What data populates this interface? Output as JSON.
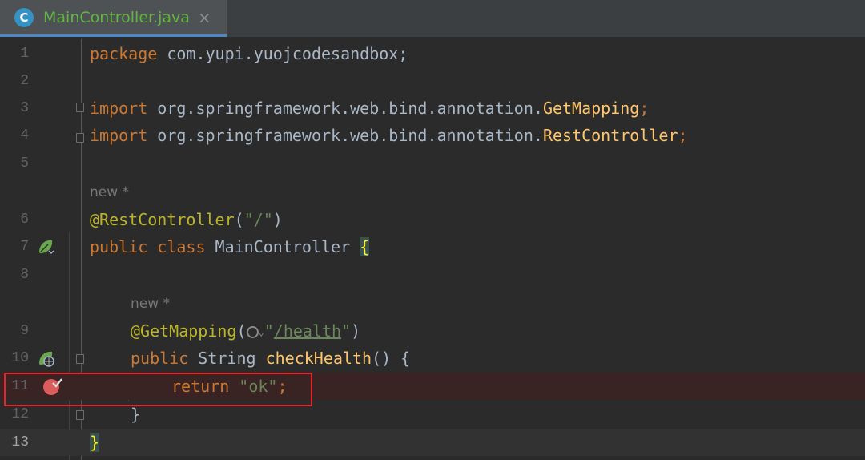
{
  "tab": {
    "icon_letter": "C",
    "title": "MainController.java",
    "close": "×"
  },
  "hints": {
    "class_hint": "new *",
    "method_hint": "new *"
  },
  "lines": {
    "l1": {
      "num": "1",
      "kw": "package",
      "rest": " com.yupi.yuojcodesandbox;"
    },
    "l2": {
      "num": "2"
    },
    "l3": {
      "num": "3",
      "kw": "import",
      "rest": " org.springframework.web.bind.annotation.",
      "cls": "GetMapping",
      "semi": ";"
    },
    "l4": {
      "num": "4",
      "kw": "import",
      "rest": " org.springframework.web.bind.annotation.",
      "cls": "RestController",
      "semi": ";"
    },
    "l5": {
      "num": "5"
    },
    "l6": {
      "num": "6",
      "ann": "@RestController",
      "open": "(",
      "str": "\"/\"",
      "close": ")"
    },
    "l7": {
      "num": "7",
      "kw": "public class",
      "rest": " MainController ",
      "brace": "{"
    },
    "l8": {
      "num": "8"
    },
    "l9": {
      "num": "9",
      "ann": "@GetMapping",
      "open": "(",
      "q1": "\"",
      "path": "/health",
      "q2": "\"",
      "close": ")"
    },
    "l10": {
      "num": "10",
      "kw": "public",
      "rest": " String ",
      "fn": "checkHealth",
      "tail": "() {"
    },
    "l11": {
      "num": "11",
      "kw": "return",
      "sp": " ",
      "str": "\"ok\"",
      "semi": ";"
    },
    "l12": {
      "num": "12",
      "brace": "}"
    },
    "l13": {
      "num": "13",
      "brace": "}"
    }
  },
  "colors": {
    "keyword": "#cc7832",
    "annotation": "#bbb529",
    "string": "#6a8759",
    "function": "#ffc66d",
    "text": "#a9b7c6",
    "highlight_box": "#e5252a"
  }
}
